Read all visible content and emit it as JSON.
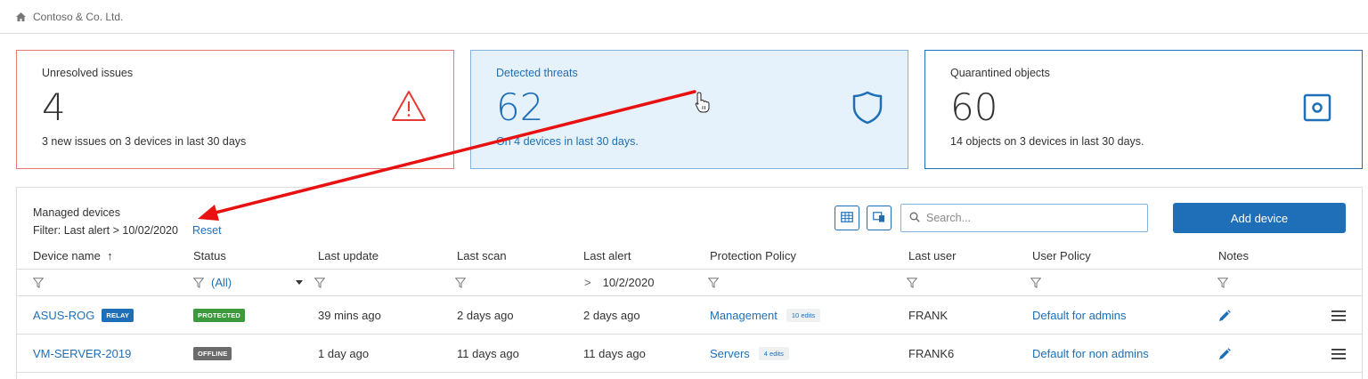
{
  "breadcrumb": {
    "company": "Contoso & Co. Ltd."
  },
  "cards": {
    "issues": {
      "title": "Unresolved issues",
      "value": "4",
      "subtitle": "3 new issues on 3 devices in last 30 days",
      "accent": "#e53935"
    },
    "threats": {
      "title": "Detected threats",
      "value": "62",
      "subtitle": "On 4 devices in last 30 days.",
      "accent": "#1e6fb8"
    },
    "quarantine": {
      "title": "Quarantined objects",
      "value": "60",
      "subtitle": "14 objects on 3 devices in last 30 days.",
      "accent": "#1e6fb8"
    }
  },
  "panel": {
    "title": "Managed devices",
    "filter_text": "Filter: Last alert > 10/02/2020",
    "reset_label": "Reset",
    "search_placeholder": "Search...",
    "add_device_label": "Add device"
  },
  "table": {
    "columns": [
      "Device name",
      "Status",
      "Last update",
      "Last scan",
      "Last alert",
      "Protection Policy",
      "Last user",
      "User Policy",
      "Notes"
    ],
    "sort_indicator": "↑",
    "filters": {
      "status": "(All)",
      "last_alert_op": ">",
      "last_alert_value": "10/2/2020"
    },
    "rows": [
      {
        "device": "ASUS-ROG",
        "device_badge": "RELAY",
        "status": "PROTECTED",
        "last_update": "39 mins ago",
        "last_scan": "2 days ago",
        "last_alert": "2 days ago",
        "policy": "Management",
        "policy_edits": "10 edits",
        "last_user": "FRANK",
        "user_policy": "Default for admins"
      },
      {
        "device": "VM-SERVER-2019",
        "device_badge": "",
        "status": "OFFLINE",
        "last_update": "1 day ago",
        "last_scan": "11 days ago",
        "last_alert": "11 days ago",
        "policy": "Servers",
        "policy_edits": "4 edits",
        "last_user": "FRANK6",
        "user_policy": "Default for non admins"
      }
    ]
  },
  "colors": {
    "link": "#1e6fb8",
    "protected": "#3c9a3c",
    "offline": "#6b6b6b",
    "annotation_arrow": "#e81010"
  },
  "icons": [
    "home-icon",
    "warning-icon",
    "shield-icon",
    "quarantine-icon",
    "grid-view-icon",
    "device-view-icon",
    "search-icon",
    "filter-icon",
    "dropdown-icon",
    "edit-pencil-icon",
    "menu-icon",
    "hand-cursor-icon"
  ]
}
